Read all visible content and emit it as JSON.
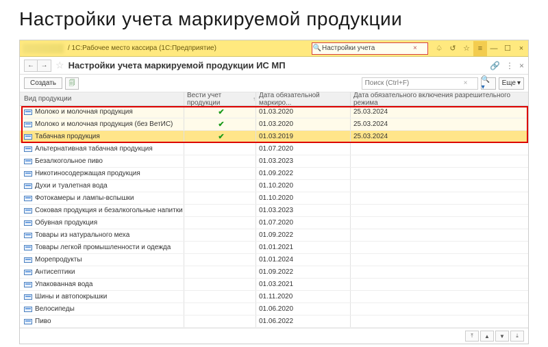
{
  "page_title": "Настройки учета маркируемой продукции",
  "titlebar": {
    "path_text": "/ 1С:Рабочее место кассира  (1С:Предприятие)",
    "search_value": "Настройки учета"
  },
  "panel": {
    "title": "Настройки учета маркируемой продукции ИС МП"
  },
  "toolbar": {
    "create_label": "Создать",
    "search_placeholder": "Поиск (Ctrl+F)",
    "more_label": "Еще"
  },
  "columns": {
    "c1": "Вид продукции",
    "c2": "Вести учет продукции",
    "c3": "Дата обязательной маркиро...",
    "c4": "Дата обязательного включения разрешительного режима"
  },
  "rows": [
    {
      "name": "Молоко и молочная продукция",
      "track": true,
      "d1": "01.03.2020",
      "d2": "25.03.2024",
      "hl": true
    },
    {
      "name": "Молоко и молочная продукция (без ВетИС)",
      "track": true,
      "d1": "01.03.2020",
      "d2": "25.03.2024",
      "hl": true
    },
    {
      "name": "Табачная продукция",
      "track": true,
      "d1": "01.03.2019",
      "d2": "25.03.2024",
      "hl": true,
      "selected": true
    },
    {
      "name": "Альтернативная табачная продукция",
      "d1": "01.07.2020"
    },
    {
      "name": "Безалкогольное пиво",
      "d1": "01.03.2023"
    },
    {
      "name": "Никотиносодержащая продукция",
      "d1": "01.09.2022"
    },
    {
      "name": "Духи и туалетная вода",
      "d1": "01.10.2020"
    },
    {
      "name": "Фотокамеры и лампы-вспышки",
      "d1": "01.10.2020"
    },
    {
      "name": "Соковая продукция и безалкогольные напитки",
      "d1": "01.03.2023"
    },
    {
      "name": "Обувная продукция",
      "d1": "01.07.2020"
    },
    {
      "name": "Товары из натурального меха",
      "d1": "01.09.2022"
    },
    {
      "name": "Товары легкой промышленности и одежда",
      "d1": "01.01.2021"
    },
    {
      "name": "Морепродукты",
      "d1": "01.01.2024"
    },
    {
      "name": "Антисептики",
      "d1": "01.09.2022"
    },
    {
      "name": "Упакованная вода",
      "d1": "01.03.2021"
    },
    {
      "name": "Шины и автопокрышки",
      "d1": "01.11.2020"
    },
    {
      "name": "Велосипеды",
      "d1": "01.06.2020"
    },
    {
      "name": "Пиво",
      "d1": "01.06.2022"
    }
  ],
  "red_box_rows": 3
}
